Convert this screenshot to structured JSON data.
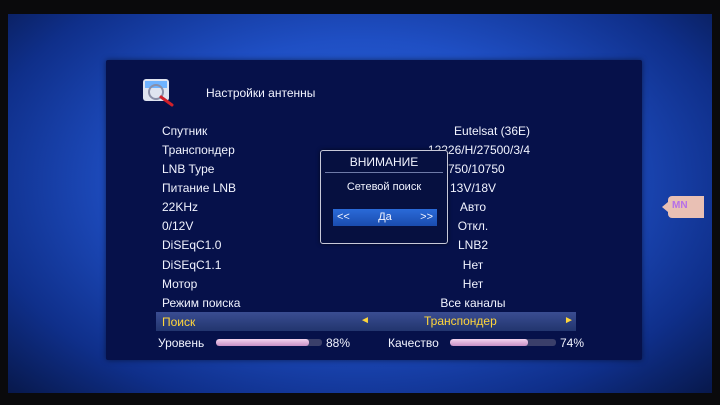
{
  "header": {
    "title": "Настройки антенны",
    "icon": "satellite-dish-search-icon"
  },
  "rows": [
    {
      "label": "Спутник",
      "value": "Eutelsat (36E)"
    },
    {
      "label": "Транспондер",
      "value": "12226/H/27500/3/4"
    },
    {
      "label": "LNB Type",
      "value": "9750/10750"
    },
    {
      "label": "Питание LNB",
      "value": "13V/18V"
    },
    {
      "label": "22KHz",
      "value": "Авто"
    },
    {
      "label": "0/12V",
      "value": "Откл."
    },
    {
      "label": "DiSEqC1.0",
      "value": "LNB2"
    },
    {
      "label": "DiSEqC1.1",
      "value": "Нет"
    },
    {
      "label": "Мотор",
      "value": "Нет"
    },
    {
      "label": "Режим поиска",
      "value": "Все каналы"
    }
  ],
  "selected_row": {
    "label": "Поиск",
    "value": "Транспондер",
    "arrow_left": "◄",
    "arrow_right": "►"
  },
  "meters": {
    "level": {
      "label": "Уровень",
      "percent_text": "88%",
      "fraction": 0.88
    },
    "quality": {
      "label": "Качество",
      "percent_text": "74%",
      "fraction": 0.74
    }
  },
  "dialog": {
    "title": "ВНИМАНИЕ",
    "message": "Сетевой поиск",
    "button": {
      "left": "<<",
      "label": "Да",
      "right": ">>"
    }
  },
  "side_tab": {
    "text": "MN"
  },
  "colors": {
    "background": "#1f4fc4",
    "panel": "#06114a",
    "highlight_text": "#ffd63a",
    "meter_fill": "#e3b3de"
  }
}
